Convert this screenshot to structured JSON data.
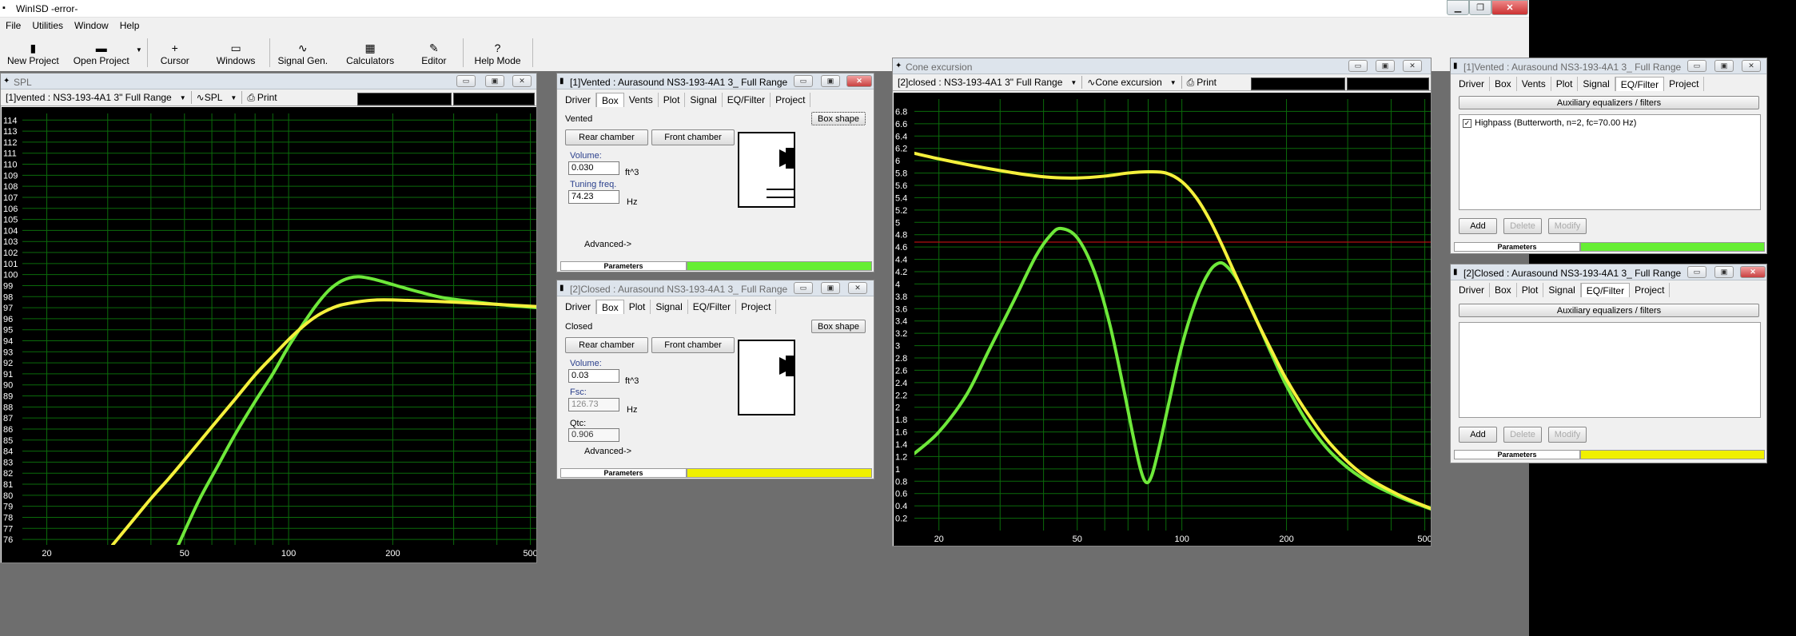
{
  "app": {
    "title": "WinISD -error-",
    "menu": [
      "File",
      "Utilities",
      "Window",
      "Help"
    ],
    "toolbar": [
      {
        "label": "New Project",
        "icon": "new-project-icon",
        "glyph": "▮"
      },
      {
        "label": "Open Project",
        "icon": "open-project-icon",
        "glyph": "▬"
      },
      {
        "label": "Cursor",
        "icon": "cursor-icon",
        "glyph": "+"
      },
      {
        "label": "Windows",
        "icon": "windows-icon",
        "glyph": "▭"
      },
      {
        "label": "Signal Gen.",
        "icon": "signal-gen-icon",
        "glyph": "∿"
      },
      {
        "label": "Calculators",
        "icon": "calculator-icon",
        "glyph": "▦"
      },
      {
        "label": "Editor",
        "icon": "editor-icon",
        "glyph": "✎"
      },
      {
        "label": "Help Mode",
        "icon": "help-icon",
        "glyph": "?"
      }
    ]
  },
  "spl": {
    "title": "SPL",
    "driver_select": "[1]vented : NS3-193-4A1 3\" Full Range",
    "graph_select": "SPL",
    "print": "Print"
  },
  "excursion": {
    "title": "Cone excursion",
    "driver_select": "[2]closed : NS3-193-4A1 3\" Full Range",
    "graph_select": "Cone excursion",
    "print": "Print"
  },
  "vented_box": {
    "title": "[1]Vented : Aurasound  NS3-193-4A1 3_ Full Range",
    "tabs": [
      "Driver",
      "Box",
      "Vents",
      "Plot",
      "Signal",
      "EQ/Filter",
      "Project"
    ],
    "box_type": "Vented",
    "box_shape": "Box shape",
    "rear": "Rear chamber",
    "front": "Front chamber",
    "volume_label": "Volume:",
    "volume": "0.030",
    "volume_unit": "ft^3",
    "tuning_label": "Tuning freq.",
    "tuning": "74.23",
    "tuning_unit": "Hz",
    "advanced": "Advanced->",
    "params": "Parameters",
    "status_color": "#66ee33"
  },
  "closed_box": {
    "title": "[2]Closed : Aurasound  NS3-193-4A1 3_ Full Range",
    "tabs": [
      "Driver",
      "Box",
      "Plot",
      "Signal",
      "EQ/Filter",
      "Project"
    ],
    "box_type": "Closed",
    "box_shape": "Box shape",
    "rear": "Rear chamber",
    "front": "Front chamber",
    "volume_label": "Volume:",
    "volume": "0.03",
    "volume_unit": "ft^3",
    "fsc_label": "Fsc:",
    "fsc": "126.73",
    "fsc_unit": "Hz",
    "qtc_label": "Qtc:",
    "qtc": "0.906",
    "advanced": "Advanced->",
    "params": "Parameters",
    "status_color": "#f0f000"
  },
  "vented_eq": {
    "title": "[1]Vented : Aurasound  NS3-193-4A1 3_ Full Range",
    "tabs": [
      "Driver",
      "Box",
      "Vents",
      "Plot",
      "Signal",
      "EQ/Filter",
      "Project"
    ],
    "header": "Auxiliary equalizers / filters",
    "items": [
      "Highpass (Butterworth, n=2, fc=70.00 Hz)"
    ],
    "add": "Add",
    "delete": "Delete",
    "modify": "Modify",
    "params": "Parameters",
    "status_color": "#66ee33"
  },
  "closed_eq": {
    "title": "[2]Closed : Aurasound  NS3-193-4A1 3_ Full Range",
    "tabs": [
      "Driver",
      "Box",
      "Plot",
      "Signal",
      "EQ/Filter",
      "Project"
    ],
    "header": "Auxiliary equalizers / filters",
    "add": "Add",
    "delete": "Delete",
    "modify": "Modify",
    "params": "Parameters",
    "status_color": "#f0f000"
  },
  "chart_data": [
    {
      "type": "line",
      "chart": "spl",
      "x_scale": "log",
      "xlim": [
        17,
        520
      ],
      "ylim": [
        75.5,
        114.6
      ],
      "x_ticks": [
        20,
        50,
        100,
        200,
        500
      ],
      "y_ticks_range": [
        76,
        114
      ],
      "grid": true,
      "series": [
        {
          "color": "#6ee83a",
          "x": [
            48,
            55,
            62,
            70,
            80,
            90,
            100,
            110,
            120,
            130,
            140,
            150,
            160,
            175,
            190,
            210,
            240,
            280,
            330,
            400,
            520
          ],
          "y": [
            75.5,
            79.5,
            82.5,
            85.5,
            88.5,
            91.0,
            93.5,
            95.5,
            97.2,
            98.5,
            99.3,
            99.7,
            99.8,
            99.6,
            99.3,
            98.9,
            98.4,
            97.9,
            97.6,
            97.3,
            97.0
          ]
        },
        {
          "color": "#f5f03c",
          "x": [
            31,
            35,
            40,
            45,
            50,
            60,
            70,
            80,
            90,
            100,
            110,
            120,
            130,
            140,
            150,
            165,
            180,
            200,
            250,
            300,
            400,
            520
          ],
          "y": [
            75.5,
            77.5,
            79.7,
            81.5,
            83.2,
            86.2,
            88.7,
            90.9,
            92.6,
            94.1,
            95.3,
            96.2,
            96.8,
            97.2,
            97.4,
            97.6,
            97.7,
            97.7,
            97.6,
            97.5,
            97.3,
            97.1
          ]
        }
      ]
    },
    {
      "type": "line",
      "chart": "cone-excursion",
      "x_scale": "log",
      "xlim": [
        17,
        520
      ],
      "ylim": [
        0,
        7.0
      ],
      "x_ticks": [
        20,
        50,
        100,
        200,
        500
      ],
      "y_ticks_range": [
        0.2,
        6.8
      ],
      "reference_line": 4.68,
      "grid": true,
      "series": [
        {
          "color": "#6ee83a",
          "x": [
            17,
            20,
            24,
            28,
            33,
            38,
            42,
            45,
            50,
            56,
            62,
            68,
            72,
            76,
            79,
            82,
            86,
            92,
            100,
            110,
            120,
            128,
            135,
            145,
            160,
            180,
            200,
            230,
            270,
            330,
            420,
            520
          ],
          "y": [
            1.25,
            1.6,
            2.2,
            2.95,
            3.75,
            4.45,
            4.8,
            4.9,
            4.75,
            4.2,
            3.35,
            2.3,
            1.6,
            1.0,
            0.78,
            0.9,
            1.35,
            2.1,
            3.0,
            3.75,
            4.2,
            4.34,
            4.28,
            4.05,
            3.55,
            2.9,
            2.35,
            1.75,
            1.25,
            0.85,
            0.55,
            0.35
          ]
        },
        {
          "color": "#f5f03c",
          "x": [
            17,
            20,
            25,
            30,
            36,
            42,
            50,
            60,
            70,
            80,
            90,
            100,
            110,
            120,
            130,
            140,
            150,
            165,
            180,
            200,
            230,
            270,
            330,
            420,
            520
          ],
          "y": [
            6.12,
            6.03,
            5.92,
            5.84,
            5.77,
            5.73,
            5.72,
            5.75,
            5.8,
            5.82,
            5.8,
            5.66,
            5.4,
            5.05,
            4.65,
            4.25,
            3.88,
            3.38,
            2.95,
            2.45,
            1.9,
            1.38,
            0.92,
            0.58,
            0.36
          ]
        }
      ]
    }
  ]
}
